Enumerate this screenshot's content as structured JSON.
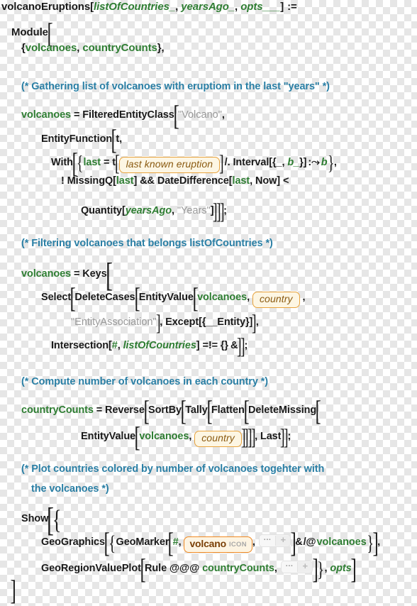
{
  "cell": {
    "language": "Wolfram Language",
    "kind": "input-code-cell",
    "background": "transparent-checkerboard"
  },
  "colors": {
    "symbol_green": "#2e7d32",
    "comment_teal": "#2a7fa5",
    "string_gray": "#9a9a9a",
    "code_black": "#1a1a1a",
    "entity_box_border": "#e8a33d",
    "entity_box_fill": "#fdf6e3",
    "entity_box_text": "#8a5a10",
    "icon_box_border": "#f08a24",
    "icon_box_text": "#7a3f06",
    "placeholder_gray": "#9b9b9b"
  },
  "code": {
    "definition_head": "volcanoEruptions",
    "params": [
      "listOfCountries_",
      "yearsAgo_",
      "opts___"
    ],
    "set_delayed": ":=",
    "module": "Module",
    "locals": [
      "volcanoes",
      "countryCounts"
    ],
    "comments": [
      "(* Gathering list of volcanoes with eruptiom in the last \"years\" *)",
      "(* Filtering volcanoes that belongs listOfCountries *)",
      "(* Compute number of volcanoes in each country *)",
      "(* Plot countries colored by number of volcanoes togehter with",
      "the volcanoes *)"
    ],
    "tokens": {
      "volcanoes": "volcanoes",
      "countryCounts": "countryCounts",
      "listOfCountries": "listOfCountries",
      "yearsAgo": "yearsAgo",
      "opts": "opts",
      "last": "last",
      "b": "b",
      "t": "t",
      "slot": "#",
      "eq": "=",
      "comma": ",",
      "semicolon": ";"
    },
    "strings": {
      "volcano": "\"Volcano\"",
      "entity_association": "\"EntityAssociation\"",
      "years": "\"Years\""
    },
    "entity_boxes": {
      "last_known_eruption": "last known eruption",
      "country": "country"
    },
    "icon_box": {
      "name": "volcano",
      "label": "ICON"
    },
    "placeholder_widget": {
      "dots": "···",
      "plus": "+"
    },
    "builtins": {
      "FilteredEntityClass": "FilteredEntityClass",
      "EntityFunction": "EntityFunction",
      "With": "With",
      "Interval": "Interval",
      "MissingQ": "MissingQ",
      "DateDifference": "DateDifference",
      "Now": "Now",
      "Quantity": "Quantity",
      "Keys": "Keys",
      "Select": "Select",
      "DeleteCases": "DeleteCases",
      "EntityValue": "EntityValue",
      "Except": "Except",
      "Entity": "Entity",
      "Intersection": "Intersection",
      "Reverse": "Reverse",
      "SortBy": "SortBy",
      "Tally": "Tally",
      "Flatten": "Flatten",
      "DeleteMissing": "DeleteMissing",
      "Last": "Last",
      "Show": "Show",
      "GeoGraphics": "GeoGraphics",
      "GeoMarker": "GeoMarker",
      "GeoRegionValuePlot": "GeoRegionValuePlot",
      "Rule": "Rule"
    },
    "operators": {
      "replace_all": "/.",
      "rule_delayed": ":⤳",
      "not": "!",
      "and": "&&",
      "less": "<",
      "unequal": "=!=",
      "empty_list": "{}",
      "function_amp": "&",
      "map": "/@",
      "apply_level": "@@@"
    },
    "lines": [
      "volcanoEruptions[listOfCountries_, yearsAgo_, opts___] :=",
      "Module[",
      "{volcanoes, countryCounts},",
      "(* Gathering list of volcanoes with eruptiom in the last \"years\" *)",
      "volcanoes = FilteredEntityClass[\"Volcano\",",
      "EntityFunction[t,",
      "With[{last = t[last known eruption] /. Interval[{_, b_}] :⤳ b},",
      "! MissingQ[last] && DateDifference[last, Now] <",
      "Quantity[yearsAgo, \"Years\"]]]];",
      "(* Filtering volcanoes that belongs listOfCountries *)",
      "volcanoes = Keys[",
      "Select[DeleteCases[EntityValue[volcanoes, country,",
      "\"EntityAssociation\"], Except[{__Entity}]],",
      "Intersection[#, listOfCountries] =!= {} &]];",
      "(* Compute number of volcanoes in each country *)",
      "countryCounts = Reverse[SortBy[Tally[Flatten[DeleteMissing[",
      "EntityValue[volcanoes, country]]]], Last]];",
      "(* Plot countries colored by number of volcanoes togehter with",
      "the volcanoes *)",
      "Show[{",
      "GeoGraphics[{GeoMarker[#, volcano ICON, ··· +] & /@ volcanoes}],",
      "GeoRegionValuePlot[Rule @@@ countryCounts, ··· +]}, opts]",
      "]"
    ]
  }
}
